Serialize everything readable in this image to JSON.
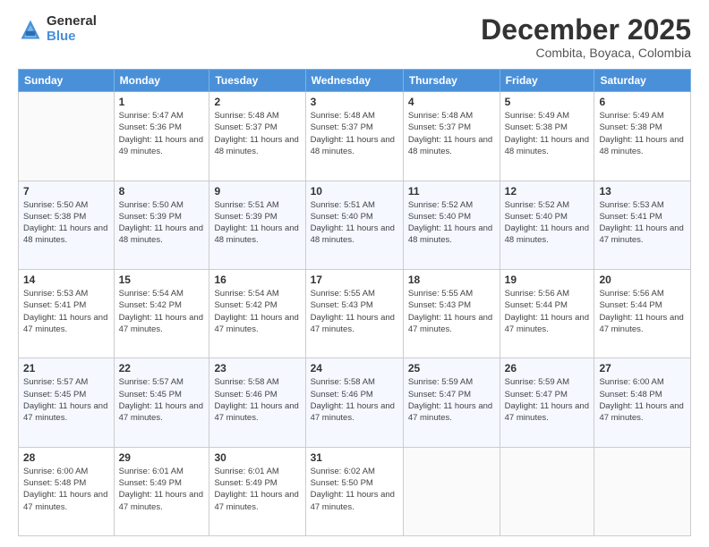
{
  "logo": {
    "general": "General",
    "blue": "Blue"
  },
  "header": {
    "month": "December 2025",
    "location": "Combita, Boyaca, Colombia"
  },
  "weekdays": [
    "Sunday",
    "Monday",
    "Tuesday",
    "Wednesday",
    "Thursday",
    "Friday",
    "Saturday"
  ],
  "weeks": [
    [
      {
        "day": "",
        "sunrise": "",
        "sunset": "",
        "daylight": ""
      },
      {
        "day": "1",
        "sunrise": "Sunrise: 5:47 AM",
        "sunset": "Sunset: 5:36 PM",
        "daylight": "Daylight: 11 hours and 49 minutes."
      },
      {
        "day": "2",
        "sunrise": "Sunrise: 5:48 AM",
        "sunset": "Sunset: 5:37 PM",
        "daylight": "Daylight: 11 hours and 48 minutes."
      },
      {
        "day": "3",
        "sunrise": "Sunrise: 5:48 AM",
        "sunset": "Sunset: 5:37 PM",
        "daylight": "Daylight: 11 hours and 48 minutes."
      },
      {
        "day": "4",
        "sunrise": "Sunrise: 5:48 AM",
        "sunset": "Sunset: 5:37 PM",
        "daylight": "Daylight: 11 hours and 48 minutes."
      },
      {
        "day": "5",
        "sunrise": "Sunrise: 5:49 AM",
        "sunset": "Sunset: 5:38 PM",
        "daylight": "Daylight: 11 hours and 48 minutes."
      },
      {
        "day": "6",
        "sunrise": "Sunrise: 5:49 AM",
        "sunset": "Sunset: 5:38 PM",
        "daylight": "Daylight: 11 hours and 48 minutes."
      }
    ],
    [
      {
        "day": "7",
        "sunrise": "Sunrise: 5:50 AM",
        "sunset": "Sunset: 5:38 PM",
        "daylight": "Daylight: 11 hours and 48 minutes."
      },
      {
        "day": "8",
        "sunrise": "Sunrise: 5:50 AM",
        "sunset": "Sunset: 5:39 PM",
        "daylight": "Daylight: 11 hours and 48 minutes."
      },
      {
        "day": "9",
        "sunrise": "Sunrise: 5:51 AM",
        "sunset": "Sunset: 5:39 PM",
        "daylight": "Daylight: 11 hours and 48 minutes."
      },
      {
        "day": "10",
        "sunrise": "Sunrise: 5:51 AM",
        "sunset": "Sunset: 5:40 PM",
        "daylight": "Daylight: 11 hours and 48 minutes."
      },
      {
        "day": "11",
        "sunrise": "Sunrise: 5:52 AM",
        "sunset": "Sunset: 5:40 PM",
        "daylight": "Daylight: 11 hours and 48 minutes."
      },
      {
        "day": "12",
        "sunrise": "Sunrise: 5:52 AM",
        "sunset": "Sunset: 5:40 PM",
        "daylight": "Daylight: 11 hours and 48 minutes."
      },
      {
        "day": "13",
        "sunrise": "Sunrise: 5:53 AM",
        "sunset": "Sunset: 5:41 PM",
        "daylight": "Daylight: 11 hours and 47 minutes."
      }
    ],
    [
      {
        "day": "14",
        "sunrise": "Sunrise: 5:53 AM",
        "sunset": "Sunset: 5:41 PM",
        "daylight": "Daylight: 11 hours and 47 minutes."
      },
      {
        "day": "15",
        "sunrise": "Sunrise: 5:54 AM",
        "sunset": "Sunset: 5:42 PM",
        "daylight": "Daylight: 11 hours and 47 minutes."
      },
      {
        "day": "16",
        "sunrise": "Sunrise: 5:54 AM",
        "sunset": "Sunset: 5:42 PM",
        "daylight": "Daylight: 11 hours and 47 minutes."
      },
      {
        "day": "17",
        "sunrise": "Sunrise: 5:55 AM",
        "sunset": "Sunset: 5:43 PM",
        "daylight": "Daylight: 11 hours and 47 minutes."
      },
      {
        "day": "18",
        "sunrise": "Sunrise: 5:55 AM",
        "sunset": "Sunset: 5:43 PM",
        "daylight": "Daylight: 11 hours and 47 minutes."
      },
      {
        "day": "19",
        "sunrise": "Sunrise: 5:56 AM",
        "sunset": "Sunset: 5:44 PM",
        "daylight": "Daylight: 11 hours and 47 minutes."
      },
      {
        "day": "20",
        "sunrise": "Sunrise: 5:56 AM",
        "sunset": "Sunset: 5:44 PM",
        "daylight": "Daylight: 11 hours and 47 minutes."
      }
    ],
    [
      {
        "day": "21",
        "sunrise": "Sunrise: 5:57 AM",
        "sunset": "Sunset: 5:45 PM",
        "daylight": "Daylight: 11 hours and 47 minutes."
      },
      {
        "day": "22",
        "sunrise": "Sunrise: 5:57 AM",
        "sunset": "Sunset: 5:45 PM",
        "daylight": "Daylight: 11 hours and 47 minutes."
      },
      {
        "day": "23",
        "sunrise": "Sunrise: 5:58 AM",
        "sunset": "Sunset: 5:46 PM",
        "daylight": "Daylight: 11 hours and 47 minutes."
      },
      {
        "day": "24",
        "sunrise": "Sunrise: 5:58 AM",
        "sunset": "Sunset: 5:46 PM",
        "daylight": "Daylight: 11 hours and 47 minutes."
      },
      {
        "day": "25",
        "sunrise": "Sunrise: 5:59 AM",
        "sunset": "Sunset: 5:47 PM",
        "daylight": "Daylight: 11 hours and 47 minutes."
      },
      {
        "day": "26",
        "sunrise": "Sunrise: 5:59 AM",
        "sunset": "Sunset: 5:47 PM",
        "daylight": "Daylight: 11 hours and 47 minutes."
      },
      {
        "day": "27",
        "sunrise": "Sunrise: 6:00 AM",
        "sunset": "Sunset: 5:48 PM",
        "daylight": "Daylight: 11 hours and 47 minutes."
      }
    ],
    [
      {
        "day": "28",
        "sunrise": "Sunrise: 6:00 AM",
        "sunset": "Sunset: 5:48 PM",
        "daylight": "Daylight: 11 hours and 47 minutes."
      },
      {
        "day": "29",
        "sunrise": "Sunrise: 6:01 AM",
        "sunset": "Sunset: 5:49 PM",
        "daylight": "Daylight: 11 hours and 47 minutes."
      },
      {
        "day": "30",
        "sunrise": "Sunrise: 6:01 AM",
        "sunset": "Sunset: 5:49 PM",
        "daylight": "Daylight: 11 hours and 47 minutes."
      },
      {
        "day": "31",
        "sunrise": "Sunrise: 6:02 AM",
        "sunset": "Sunset: 5:50 PM",
        "daylight": "Daylight: 11 hours and 47 minutes."
      },
      {
        "day": "",
        "sunrise": "",
        "sunset": "",
        "daylight": ""
      },
      {
        "day": "",
        "sunrise": "",
        "sunset": "",
        "daylight": ""
      },
      {
        "day": "",
        "sunrise": "",
        "sunset": "",
        "daylight": ""
      }
    ]
  ]
}
